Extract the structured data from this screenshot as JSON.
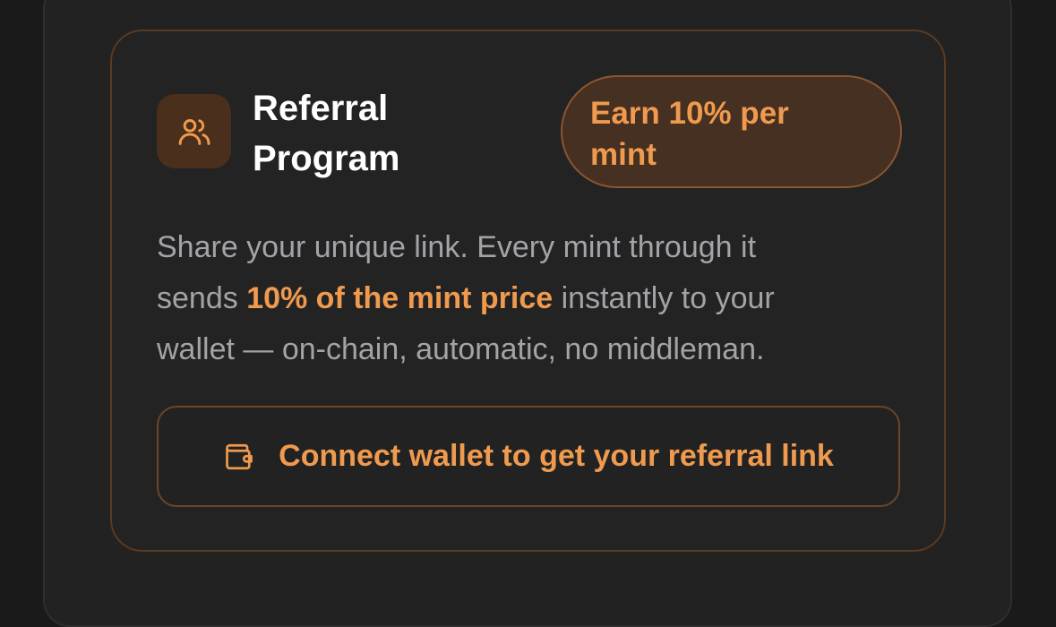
{
  "referral": {
    "title_line1": "Referral",
    "title_line2": "Program",
    "badge_line1": "Earn 10% per",
    "badge_line2": "mint",
    "desc_line1": "Share your unique link. Every mint through it",
    "desc_before": "sends ",
    "desc_highlight": "10% of the mint price",
    "desc_after": " instantly to your",
    "desc_line3": "wallet — on-chain, automatic, no middleman.",
    "connect_label": "Connect wallet to get your referral link",
    "icons": {
      "header": "users-icon",
      "button": "wallet-icon"
    }
  },
  "colors": {
    "accent": "#ef9a4e",
    "background": "#222222",
    "badge_bg": "#463021",
    "icon_tile_bg": "#4a2f1c",
    "muted_text": "#a3a3a8"
  }
}
